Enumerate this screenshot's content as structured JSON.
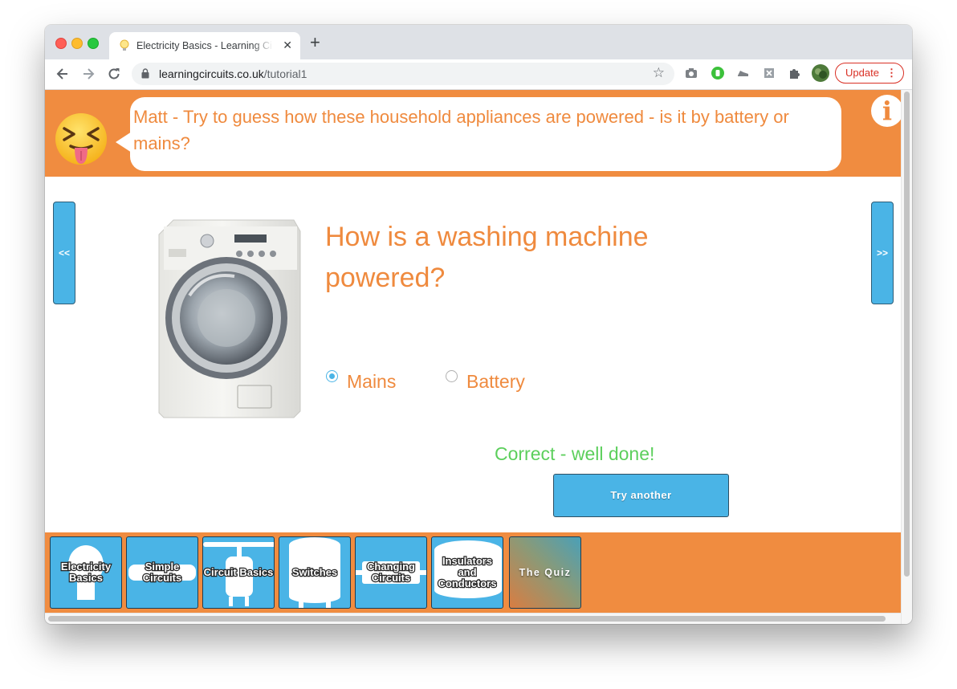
{
  "browser": {
    "tab_title": "Electricity Basics - Learning Circuits",
    "url_host": "learningcircuits.co.uk",
    "url_path": "/tutorial1",
    "update_label": "Update",
    "update_dots": "⋮",
    "tab_close": "✕",
    "new_tab": "+"
  },
  "header": {
    "speech": "Matt - Try to guess how these household appliances are powered - is it by battery or mains?",
    "info_label": "i"
  },
  "nav": {
    "prev_label": "<<",
    "next_label": ">>"
  },
  "question": {
    "text": "How is a washing machine powered?",
    "options": [
      "Mains",
      "Battery"
    ],
    "selected": "Mains",
    "feedback": "Correct - well done!",
    "try_label": "Try another"
  },
  "footer": {
    "tiles": [
      "Electricity Basics",
      "Simple Circuits",
      "Circuit Basics",
      "Switches",
      "Changing Circuits",
      "Insulators and Conductors",
      "The Quiz"
    ]
  },
  "colors": {
    "accent_orange": "#f08c40",
    "tile_blue": "#4ab4e6",
    "correct_green": "#5ccf5c"
  }
}
